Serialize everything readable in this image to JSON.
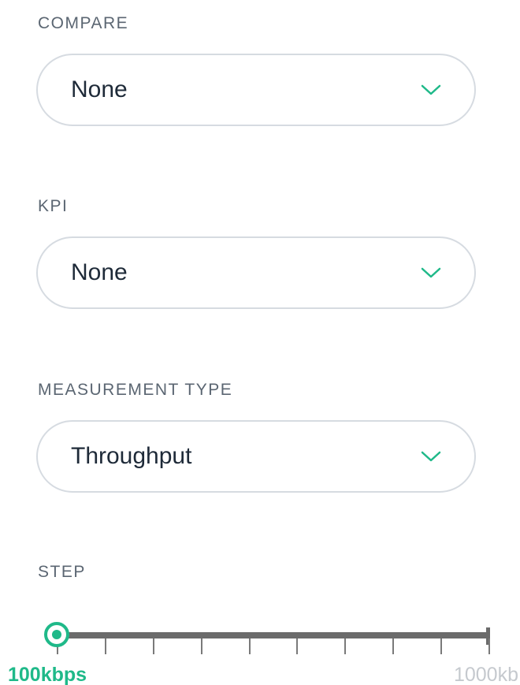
{
  "compare": {
    "label": "COMPARE",
    "value": "None"
  },
  "kpi": {
    "label": "KPI",
    "value": "None"
  },
  "measurement_type": {
    "label": "MEASUREMENT TYPE",
    "value": "Throughput"
  },
  "step": {
    "label": "STEP",
    "min_label": "100kbps",
    "max_label": "1000kb",
    "value_fraction": 0,
    "tick_count": 10
  },
  "colors": {
    "accent": "#1fb989",
    "text": "#1e2a38",
    "label": "#5b6672",
    "border": "#d6dbe1",
    "track": "#6b6b6b",
    "muted": "#c5c9ce"
  },
  "icons": {
    "dropdown": "chevron-down-icon"
  }
}
